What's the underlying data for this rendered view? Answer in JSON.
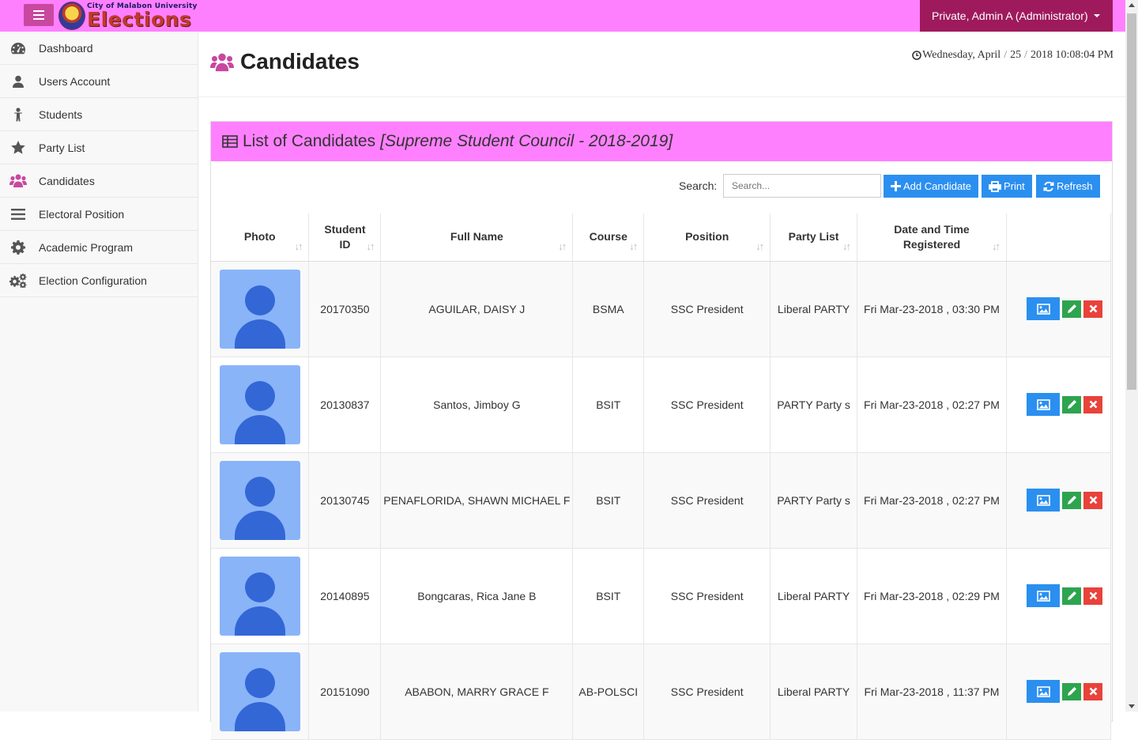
{
  "app": {
    "brand_small": "City of Malabon University",
    "brand_big": "Elections",
    "user_menu_label": "Private, Admin A (Administrator)"
  },
  "sidebar": {
    "items": [
      {
        "label": "Dashboard",
        "icon": "dashboard-icon"
      },
      {
        "label": "Users Account",
        "icon": "user-icon"
      },
      {
        "label": "Students",
        "icon": "child-icon"
      },
      {
        "label": "Party List",
        "icon": "star-icon"
      },
      {
        "label": "Candidates",
        "icon": "users-icon",
        "active": true
      },
      {
        "label": "Electoral Position",
        "icon": "bars-icon"
      },
      {
        "label": "Academic Program",
        "icon": "gear-icon"
      },
      {
        "label": "Election Configuration",
        "icon": "gears-icon"
      }
    ]
  },
  "header": {
    "title": "Candidates",
    "clock": {
      "day": "Wednesday, April",
      "date": "25",
      "rest": "2018 10:08:04 PM"
    }
  },
  "panel": {
    "title": "List of Candidates",
    "subtitle": "[Supreme Student Council - 2018-2019]",
    "search_label": "Search:",
    "search_placeholder": "Search...",
    "buttons": {
      "add": "Add Candidate",
      "print": "Print",
      "refresh": "Refresh"
    }
  },
  "table": {
    "columns": [
      "Photo",
      "Student ID",
      "Full Name",
      "Course",
      "Position",
      "Party List",
      "Date and Time Registered",
      ""
    ],
    "rows": [
      {
        "student_id": "20170350",
        "full_name": "AGUILAR, DAISY J",
        "course": "BSMA",
        "position": "SSC President",
        "party": "Liberal PARTY",
        "registered": "Fri Mar-23-2018 , 03:30 PM"
      },
      {
        "student_id": "20130837",
        "full_name": "Santos, Jimboy G",
        "course": "BSIT",
        "position": "SSC President",
        "party": "PARTY Party s",
        "registered": "Fri Mar-23-2018 , 02:27 PM"
      },
      {
        "student_id": "20130745",
        "full_name": "PENAFLORIDA, SHAWN MICHAEL F",
        "course": "BSIT",
        "position": "SSC President",
        "party": "PARTY Party s",
        "registered": "Fri Mar-23-2018 , 02:27 PM"
      },
      {
        "student_id": "20140895",
        "full_name": "Bongcaras, Rica Jane B",
        "course": "BSIT",
        "position": "SSC President",
        "party": "Liberal PARTY",
        "registered": "Fri Mar-23-2018 , 02:29 PM"
      },
      {
        "student_id": "20151090",
        "full_name": "ABABON, MARRY GRACE F",
        "course": "AB-POLSCI",
        "position": "SSC President",
        "party": "Liberal PARTY",
        "registered": "Fri Mar-23-2018 , 11:37 PM"
      }
    ]
  },
  "colors": {
    "topbar": "#ff80ff",
    "user_menu": "#9e1a5c",
    "accent": "#c8489f",
    "primary": "#2b8ff0",
    "success": "#2ea44f",
    "danger": "#e8423a"
  }
}
